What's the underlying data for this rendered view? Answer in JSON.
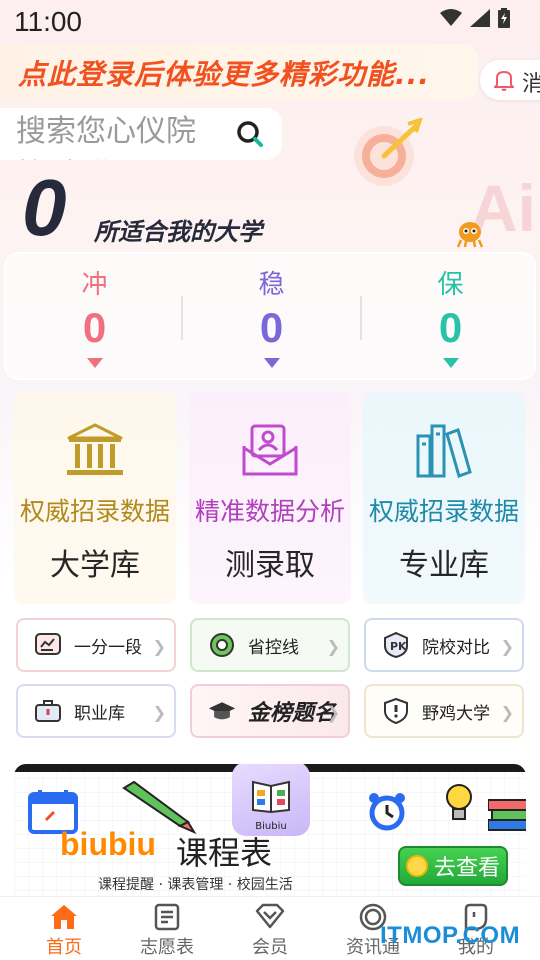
{
  "status_bar": {
    "time": "11:00"
  },
  "login_banner": {
    "text": "点此登录后体验更多精彩功能..."
  },
  "message": {
    "label": "消"
  },
  "search": {
    "placeholder": "搜索您心仪院校/专业"
  },
  "deco": {
    "ai_text": "Ai"
  },
  "recommend": {
    "count": "0",
    "label": "所适合我的大学"
  },
  "stats": [
    {
      "label": "冲",
      "value": "0",
      "color": "#f0707f"
    },
    {
      "label": "稳",
      "value": "0",
      "color": "#7b68d8"
    },
    {
      "label": "保",
      "value": "0",
      "color": "#26c3a6"
    }
  ],
  "features": [
    {
      "subtitle": "权威招录数据",
      "title": "大学库",
      "icon": "university-icon",
      "color": "#b08a1c"
    },
    {
      "subtitle": "精准数据分析",
      "title": "测录取",
      "icon": "admission-icon",
      "color": "#b23fbd"
    },
    {
      "subtitle": "权威招录数据",
      "title": "专业库",
      "icon": "books-icon",
      "color": "#1f8aa8"
    }
  ],
  "tools": [
    {
      "label": "一分一段",
      "icon": "chart-icon"
    },
    {
      "label": "省控线",
      "icon": "province-icon"
    },
    {
      "label": "院校对比",
      "icon": "compare-icon"
    },
    {
      "label": "职业库",
      "icon": "briefcase-icon"
    },
    {
      "label": "金榜题名",
      "icon": "graduation-cap-icon"
    },
    {
      "label": "野鸡大学",
      "icon": "shield-warning-icon"
    }
  ],
  "promo": {
    "brand": "biubiu",
    "title": "课程表",
    "tags": "课程提醒 · 课表管理 · 校园生活",
    "app_name": "Biubiu",
    "cta": "去查看"
  },
  "tabs": [
    {
      "label": "首页",
      "icon": "home-icon",
      "active": true
    },
    {
      "label": "志愿表",
      "icon": "form-icon",
      "active": false
    },
    {
      "label": "会员",
      "icon": "vip-icon",
      "active": false
    },
    {
      "label": "资讯通",
      "icon": "news-icon",
      "active": false
    },
    {
      "label": "我的",
      "icon": "profile-icon",
      "active": false
    }
  ],
  "watermark": "ITMOP.COM"
}
